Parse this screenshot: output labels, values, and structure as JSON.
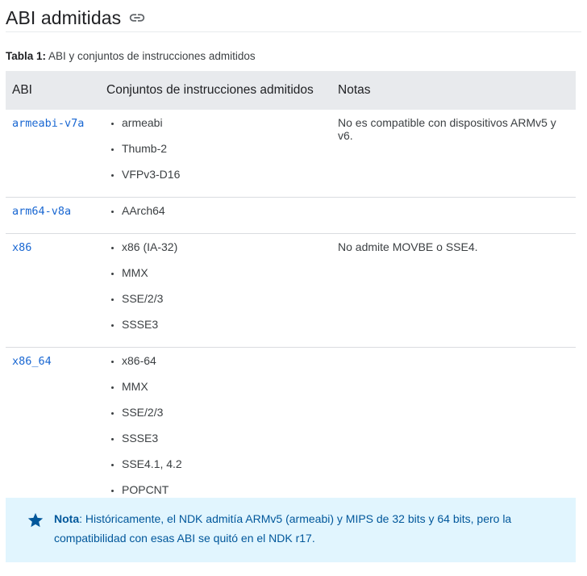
{
  "section": {
    "title": "ABI admitidas",
    "link_icon": "link-icon"
  },
  "caption": {
    "label": "Tabla 1:",
    "text": "ABI y conjuntos de instrucciones admitidos"
  },
  "table": {
    "headers": [
      "ABI",
      "Conjuntos de instrucciones admitidos",
      "Notas"
    ],
    "rows": [
      {
        "abi": "armeabi-v7a",
        "sets": [
          "armeabi",
          "Thumb-2",
          "VFPv3-D16"
        ],
        "notes": "No es compatible con dispositivos ARMv5 y v6."
      },
      {
        "abi": "arm64-v8a",
        "sets": [
          "AArch64"
        ],
        "notes": ""
      },
      {
        "abi": "x86",
        "sets": [
          "x86 (IA-32)",
          "MMX",
          "SSE/2/3",
          "SSSE3"
        ],
        "notes": "No admite MOVBE o SSE4."
      },
      {
        "abi": "x86_64",
        "sets": [
          "x86-64",
          "MMX",
          "SSE/2/3",
          "SSSE3",
          "SSE4.1, 4.2",
          "POPCNT"
        ],
        "notes": ""
      }
    ]
  },
  "note": {
    "icon": "star-icon",
    "label": "Nota",
    "separator": ":",
    "text": " Históricamente, el NDK admitía ARMv5 (armeabi) y MIPS de 32 bits y 64 bits, pero la compatibilidad con esas ABI se quitó en el NDK r17."
  },
  "colors": {
    "link": "#1967d2",
    "header_bg": "#e8eaed",
    "note_bg": "#e1f5fe",
    "note_text": "#01579b"
  }
}
